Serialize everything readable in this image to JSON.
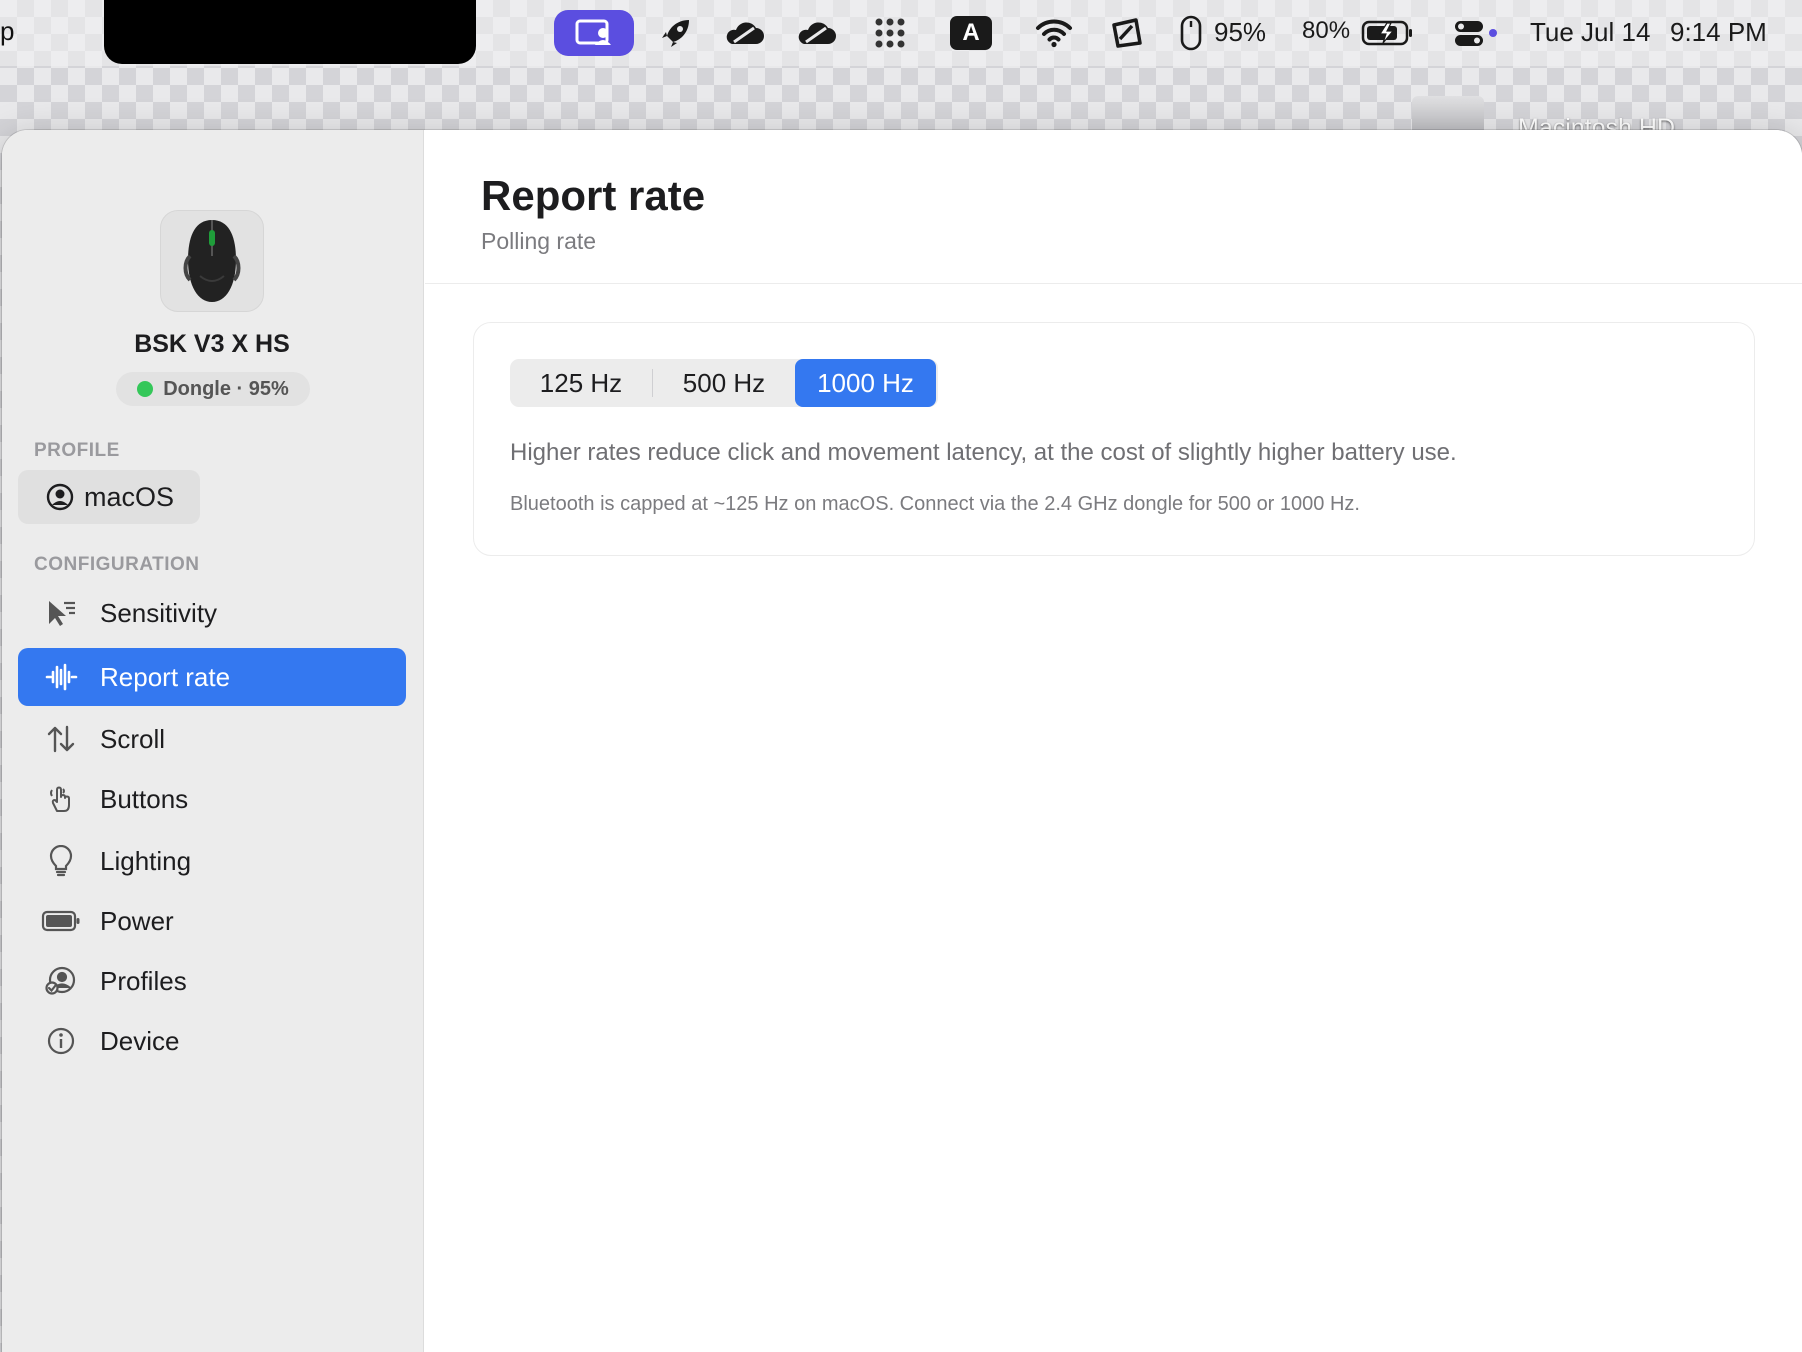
{
  "menubar": {
    "left_text": "p",
    "mouse_battery": "95%",
    "battery_percent": "80%",
    "input_letter": "A",
    "date": "Tue Jul 14",
    "time": "9:14 PM",
    "icons": [
      "screen-share-icon",
      "rocket-icon",
      "cloud-icon",
      "cloud-icon",
      "grid-icon",
      "input-source-icon",
      "wifi-icon",
      "rotation-icon",
      "mouse-icon",
      "battery-icon",
      "control-center-icon"
    ],
    "accent_color": "#5b4ee0"
  },
  "desktop": {
    "drive_label": "Macintosh HD"
  },
  "sidebar": {
    "device_name": "BSK V3 X HS",
    "connection": "Dongle · 95%",
    "connection_color": "#34c759",
    "profile_section": "PROFILE",
    "profile_name": "macOS",
    "config_section": "CONFIGURATION",
    "items": [
      {
        "label": "Sensitivity",
        "icon": "cursor-speed-icon"
      },
      {
        "label": "Report rate",
        "icon": "waveform-icon",
        "active": true
      },
      {
        "label": "Scroll",
        "icon": "arrows-up-down-icon"
      },
      {
        "label": "Buttons",
        "icon": "hand-pointer-icon"
      },
      {
        "label": "Lighting",
        "icon": "lightbulb-icon"
      },
      {
        "label": "Power",
        "icon": "battery-icon"
      },
      {
        "label": "Profiles",
        "icon": "profiles-icon"
      },
      {
        "label": "Device",
        "icon": "info-icon"
      }
    ]
  },
  "main": {
    "title": "Report rate",
    "subtitle": "Polling rate",
    "rates": [
      "125 Hz",
      "500 Hz",
      "1000 Hz"
    ],
    "selected_rate": "1000 Hz",
    "description": "Higher rates reduce click and movement latency, at the cost of slightly higher battery use.",
    "note": "Bluetooth is capped at ~125 Hz on macOS. Connect via the 2.4 GHz dongle for 500 or 1000 Hz.",
    "accent_color": "#3478f0"
  }
}
